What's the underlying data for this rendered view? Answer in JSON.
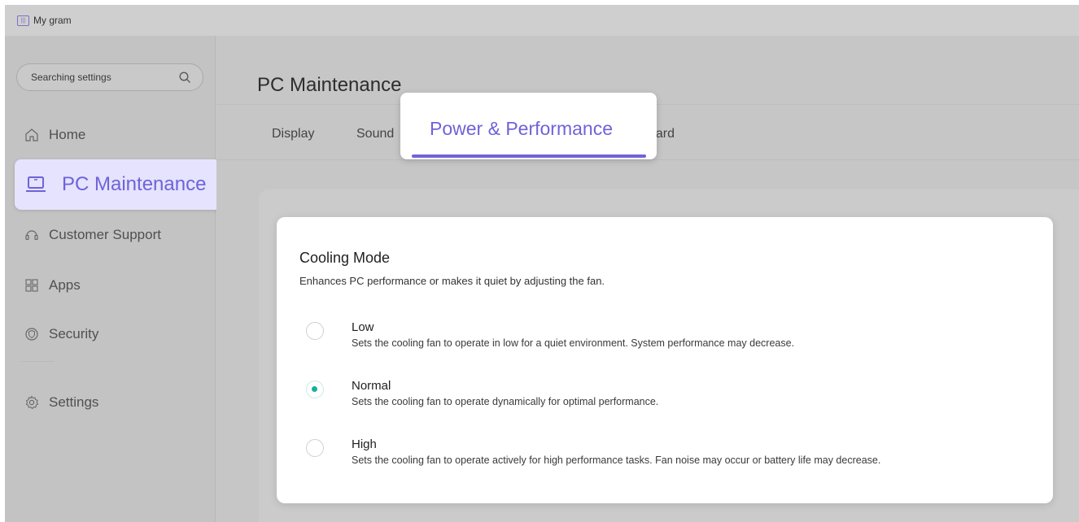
{
  "app": {
    "title": "My gram",
    "logo_text": "|||"
  },
  "sidebar": {
    "search_placeholder": "Searching settings",
    "items": [
      {
        "label": "Home",
        "icon": "home-icon"
      },
      {
        "label": "PC Maintenance",
        "icon": "laptop-icon",
        "active": true
      },
      {
        "label": "Customer Support",
        "icon": "headset-icon"
      },
      {
        "label": "Apps",
        "icon": "grid-icon"
      },
      {
        "label": "Security",
        "icon": "shield-icon"
      },
      {
        "label": "Settings",
        "icon": "gear-icon"
      }
    ]
  },
  "main": {
    "title": "PC Maintenance",
    "tabs": [
      {
        "label": "Display"
      },
      {
        "label": "Sound"
      },
      {
        "label": "Power & Performance",
        "active": true
      },
      {
        "label": "Keyboard",
        "visible_text": "oard"
      }
    ]
  },
  "cooling": {
    "title": "Cooling Mode",
    "description": "Enhances PC performance or makes it quiet by adjusting the fan.",
    "options": [
      {
        "label": "Low",
        "description": "Sets the cooling fan to operate in low for a quiet environment. System performance may decrease.",
        "selected": false
      },
      {
        "label": "Normal",
        "description": "Sets the cooling fan to operate dynamically for optimal performance.",
        "selected": true
      },
      {
        "label": "High",
        "description": "Sets the cooling fan to operate actively for high performance tasks. Fan noise may occur or battery life may decrease.",
        "selected": false
      }
    ]
  },
  "colors": {
    "accent": "#6e63d9",
    "active_bg": "#e5e3fd",
    "radio_selected": "#17b09a"
  }
}
